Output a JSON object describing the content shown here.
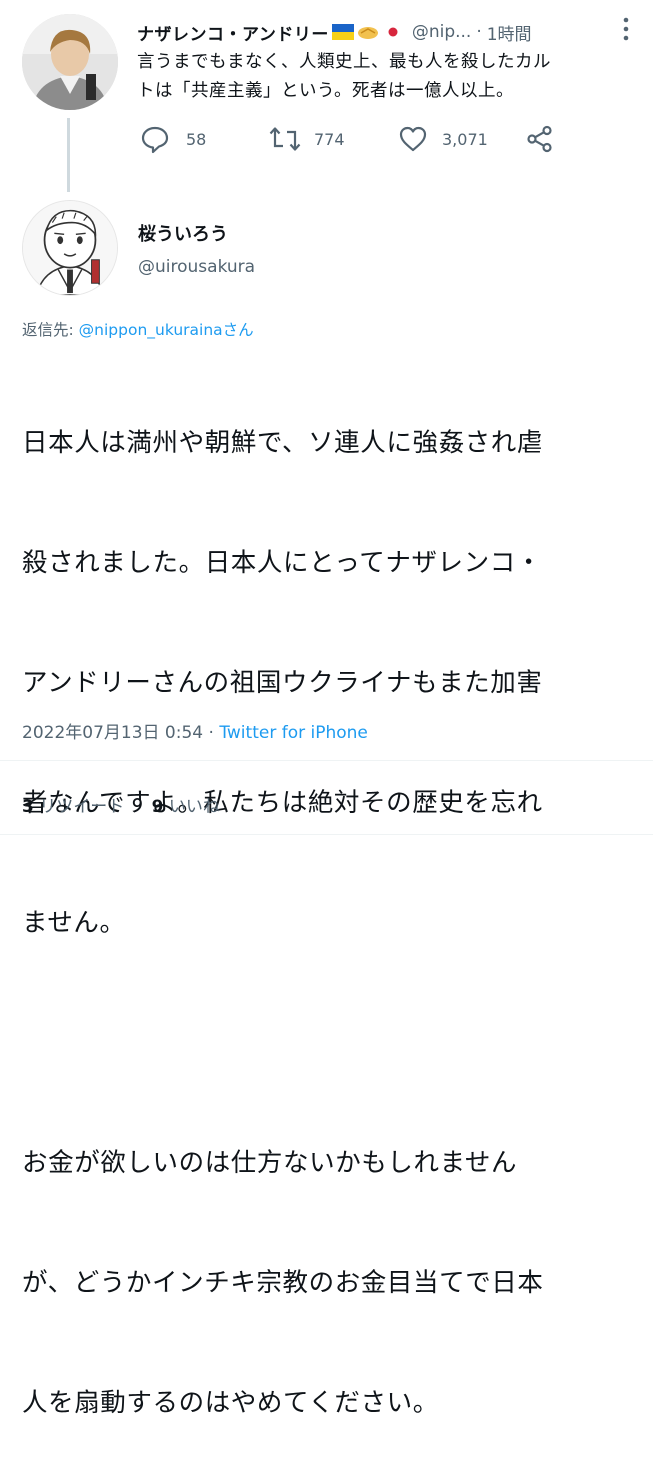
{
  "original_tweet": {
    "display_name": "ナザレンコ・アンドリー",
    "emoji_flags": [
      "ukraine-flag-icon",
      "handshake-icon",
      "japan-flag-icon"
    ],
    "handle": "@nip...",
    "separator": "·",
    "time": "1時間",
    "text_line1": "言うまでもまなく、人類史上、最も人を殺したカル",
    "text_line2": "トは「共産主義」という。死者は一億人以上。",
    "replies": "58",
    "retweets": "774",
    "likes": "3,071"
  },
  "reply_tweet": {
    "display_name": "桜ういろう",
    "handle": "@uirousakura",
    "reply_prefix": "返信先: ",
    "reply_to": "@nippon_ukurainaさん",
    "paragraph1_lines": [
      "日本人は満州や朝鮮で、ソ連人に強姦され虐",
      "殺されました。日本人にとってナザレンコ・",
      "アンドリーさんの祖国ウクライナもまた加害",
      "者なんですよ。私たちは絶対その歴史を忘れ",
      "ません。"
    ],
    "paragraph2_lines": [
      "お金が欲しいのは仕方ないかもしれません",
      "が、どうかインチキ宗教のお金目当てで日本",
      "人を扇動するのはやめてください。"
    ],
    "timestamp": "2022年07月13日 0:54",
    "meta_separator": " · ",
    "source": "Twitter for iPhone",
    "retweet_count": "3",
    "retweet_label": "リツイート",
    "like_count": "9",
    "like_label": "いいね"
  },
  "colors": {
    "text": "#0f1419",
    "secondary": "#536471",
    "link": "#1d9bf0",
    "divider": "#eff3f4"
  }
}
